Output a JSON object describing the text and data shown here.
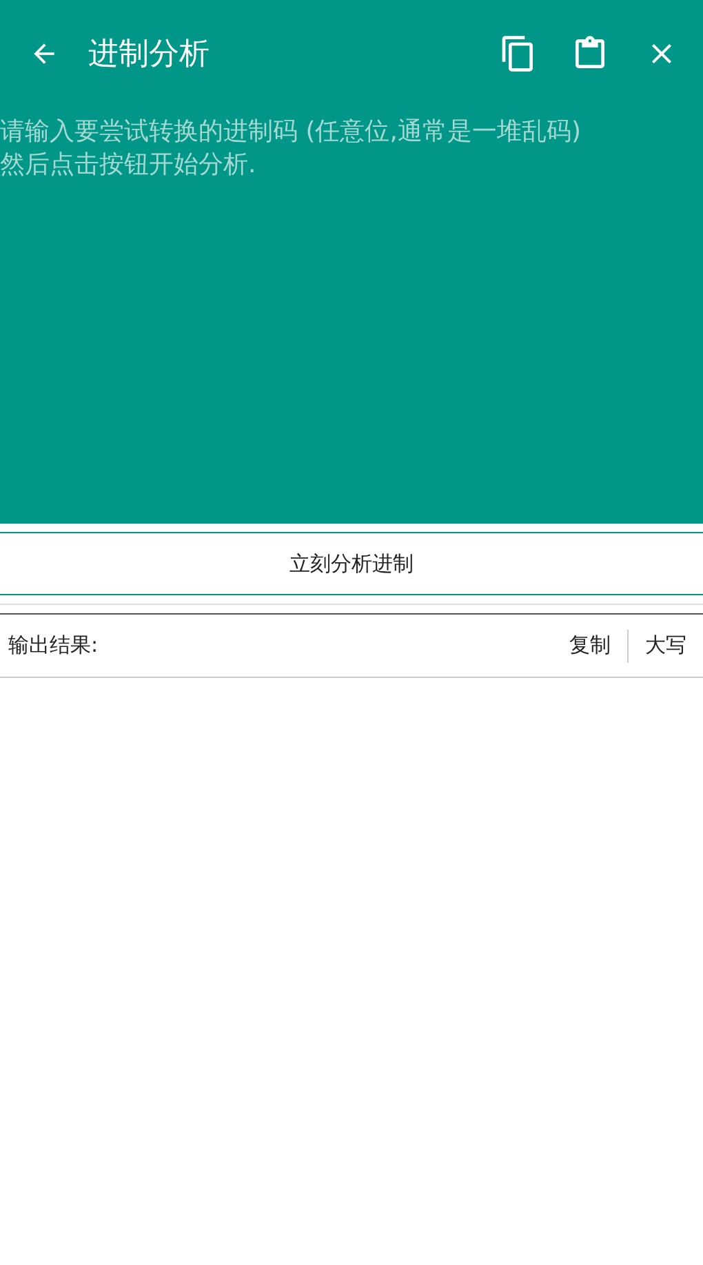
{
  "app_bar": {
    "title": "进制分析"
  },
  "input": {
    "placeholder": "请输入要尝试转换的进制码 (任意位,通常是一堆乱码)\n然后点击按钮开始分析."
  },
  "analyze_button": "立刻分析进制",
  "output": {
    "label": "输出结果:",
    "actions": [
      "复制",
      "大写"
    ]
  }
}
